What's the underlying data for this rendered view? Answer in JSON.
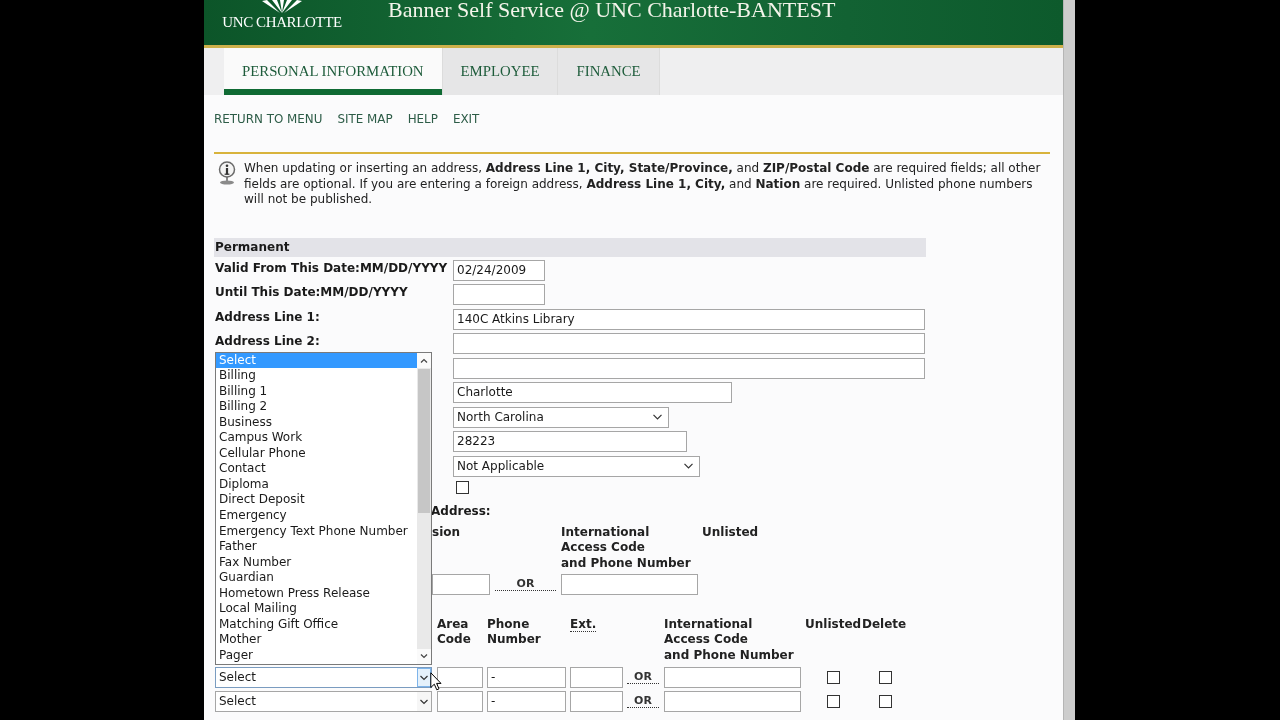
{
  "header": {
    "logo_text": "UNC CHARLOTTE",
    "title": "Banner Self Service @ UNC Charlotte-BANTEST"
  },
  "tabs": [
    {
      "label": "PERSONAL INFORMATION",
      "selected": true
    },
    {
      "label": "EMPLOYEE",
      "selected": false
    },
    {
      "label": "FINANCE",
      "selected": false
    }
  ],
  "nav_links": [
    "RETURN TO MENU",
    "SITE MAP",
    "HELP",
    "EXIT"
  ],
  "info_message": "When updating or inserting an address, **Address Line 1, City, State/Province,** and **ZIP/Postal Code** are required fields; all other fields are optional. If you are entering a foreign address, **Address Line 1, City,** and **Nation** are required. Unlisted phone numbers will not be published.",
  "address": {
    "heading": "Permanent",
    "fields": [
      {
        "label": "Valid From This Date:MM/DD/YYYY",
        "kind": "text",
        "value": "02/24/2009"
      },
      {
        "label": "Until This Date:MM/DD/YYYY",
        "kind": "text"
      },
      {
        "label": "Address Line 1:",
        "kind": "text",
        "value": "140C Atkins Library"
      },
      {
        "label": "Address Line 2:",
        "kind": "text"
      },
      {
        "kind": "text"
      },
      {
        "kind": "text",
        "value": "Charlotte"
      },
      {
        "kind": "select",
        "value": "North Carolina"
      },
      {
        "kind": "text",
        "value": "28223"
      },
      {
        "kind": "select",
        "value": "Not Applicable"
      },
      {
        "kind": "checkbox",
        "checked": false
      }
    ]
  },
  "primary_phone": {
    "heading": "Address:",
    "columns": [
      "sion",
      "International\nAccess Code\nand Phone Number",
      "Unlisted"
    ],
    "separator": "OR"
  },
  "phone_table": {
    "columns": [
      {
        "label": "Area Code",
        "kind": "plain"
      },
      {
        "label": "Phone Number",
        "kind": "plain"
      },
      {
        "label": "Ext.",
        "kind": "abbr"
      },
      {
        "label": "International\nAccess Code\nand Phone Number",
        "kind": "plain"
      },
      {
        "label": "Unlisted",
        "kind": "plain"
      },
      {
        "label": "Delete",
        "kind": "plain"
      }
    ],
    "rows": [
      {
        "type": "Select",
        "expanded": true,
        "phone_number": "-",
        "separator": "OR",
        "unlisted": false,
        "delete": false
      },
      {
        "type": "Select",
        "expanded": false,
        "phone_number": "-",
        "separator": "OR",
        "unlisted": false,
        "delete": false
      }
    ],
    "type_options": [
      {
        "label": "Select",
        "selected": true
      },
      {
        "label": "Billing",
        "selected": false
      },
      {
        "label": "Billing 1",
        "selected": false
      },
      {
        "label": "Billing 2",
        "selected": false
      },
      {
        "label": "Business",
        "selected": false
      },
      {
        "label": "Campus Work",
        "selected": false
      },
      {
        "label": "Cellular Phone",
        "selected": false
      },
      {
        "label": "Contact",
        "selected": false
      },
      {
        "label": "Diploma",
        "selected": false
      },
      {
        "label": "Direct Deposit",
        "selected": false
      },
      {
        "label": "Emergency",
        "selected": false
      },
      {
        "label": "Emergency Text Phone Number",
        "selected": false
      },
      {
        "label": "Father",
        "selected": false
      },
      {
        "label": "Fax Number",
        "selected": false
      },
      {
        "label": "Guardian",
        "selected": false
      },
      {
        "label": "Hometown Press Release",
        "selected": false
      },
      {
        "label": "Local Mailing",
        "selected": false
      },
      {
        "label": "Matching Gift Office",
        "selected": false
      },
      {
        "label": "Mother",
        "selected": false
      },
      {
        "label": "Pager",
        "selected": false
      }
    ]
  }
}
